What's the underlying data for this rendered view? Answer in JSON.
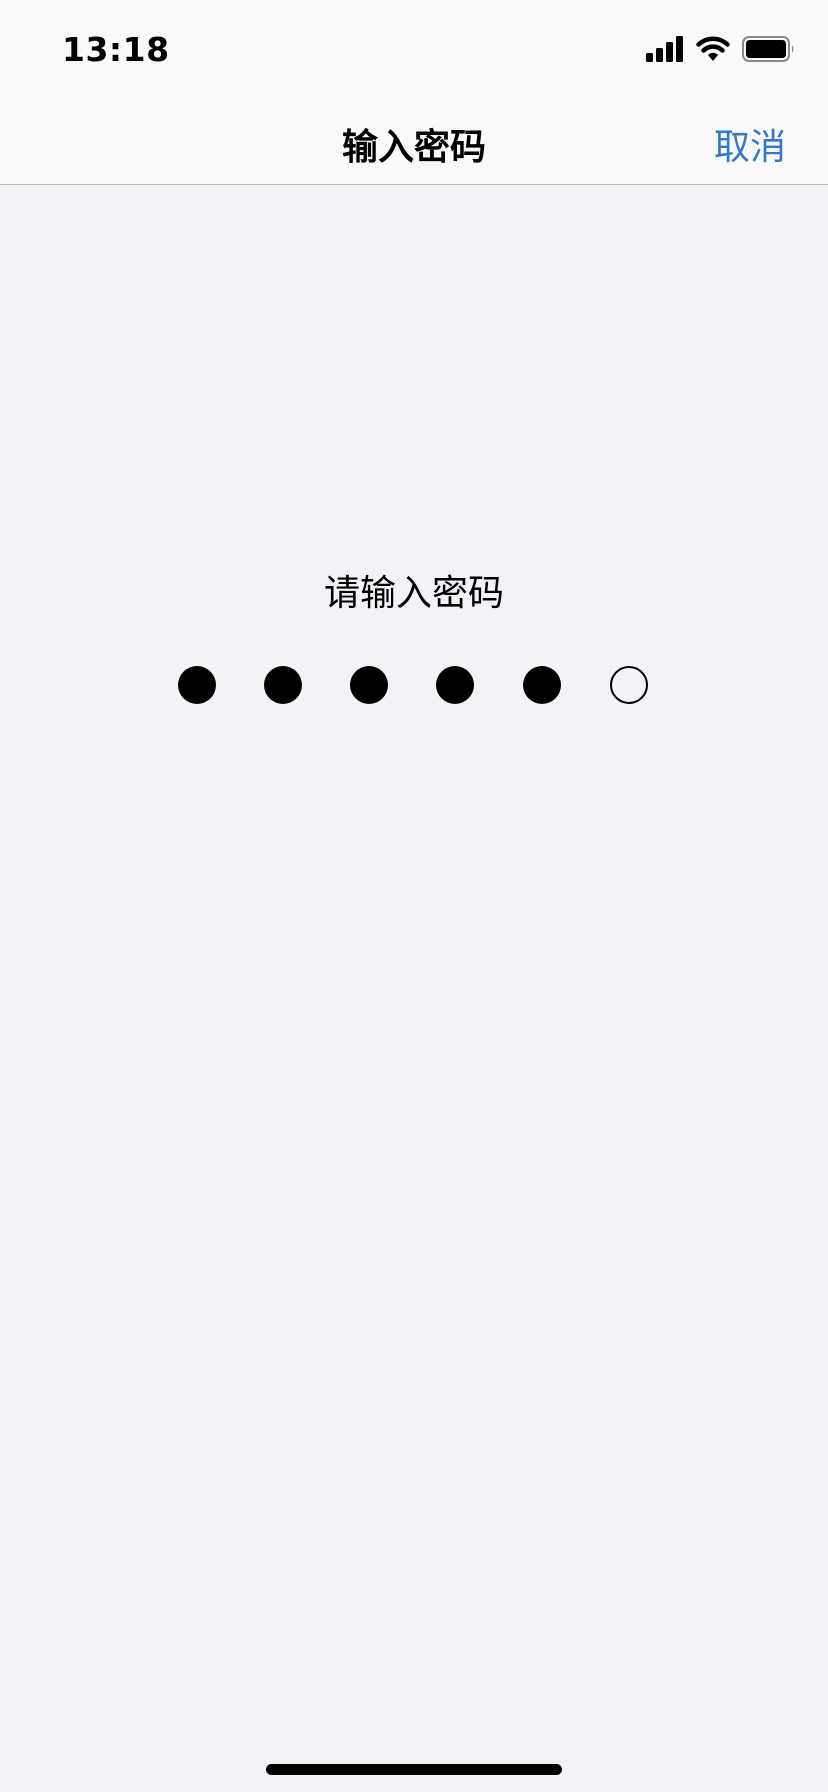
{
  "status_bar": {
    "time": "13:18",
    "icons": [
      "signal-icon",
      "wifi-icon",
      "battery-icon"
    ]
  },
  "nav": {
    "title": "输入密码",
    "cancel_label": "取消"
  },
  "passcode": {
    "prompt": "请输入密码",
    "length": 6,
    "entered": 5
  },
  "colors": {
    "background": "#f2f2f7",
    "bar_background": "#f9f9fb",
    "accent": "#3478c6",
    "dot": "#000000"
  }
}
